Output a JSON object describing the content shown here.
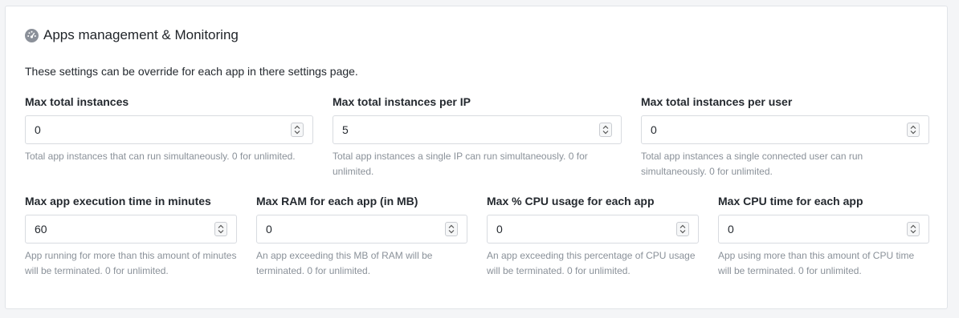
{
  "section": {
    "title": "Apps management & Monitoring",
    "icon": "dashboard-icon",
    "description": "These settings can be override for each app in there settings page."
  },
  "fields": [
    {
      "label": "Max total instances",
      "value": "0",
      "help": "Total app instances that can run simultaneously. 0 for unlimited."
    },
    {
      "label": "Max total instances per IP",
      "value": "5",
      "help": "Total app instances a single IP can run simultaneously. 0 for unlimited."
    },
    {
      "label": "Max total instances per user",
      "value": "0",
      "help": "Total app instances a single connected user can run simultaneously. 0 for unlimited."
    },
    {
      "label": "Max app execution time in minutes",
      "value": "60",
      "help": "App running for more than this amount of minutes will be terminated. 0 for unlimited."
    },
    {
      "label": "Max RAM for each app (in MB)",
      "value": "0",
      "help": "An app exceeding this MB of RAM will be terminated. 0 for unlimited."
    },
    {
      "label": "Max % CPU usage for each app",
      "value": "0",
      "help": "An app exceeding this percentage of CPU usage will be terminated. 0 for unlimited."
    },
    {
      "label": "Max CPU time for each app",
      "value": "0",
      "help": "App using more than this amount of CPU time will be terminated. 0 for unlimited."
    }
  ],
  "colors": {
    "help_text": "#8a9199",
    "border": "#d8dbe0",
    "icon": "#8b9099"
  }
}
